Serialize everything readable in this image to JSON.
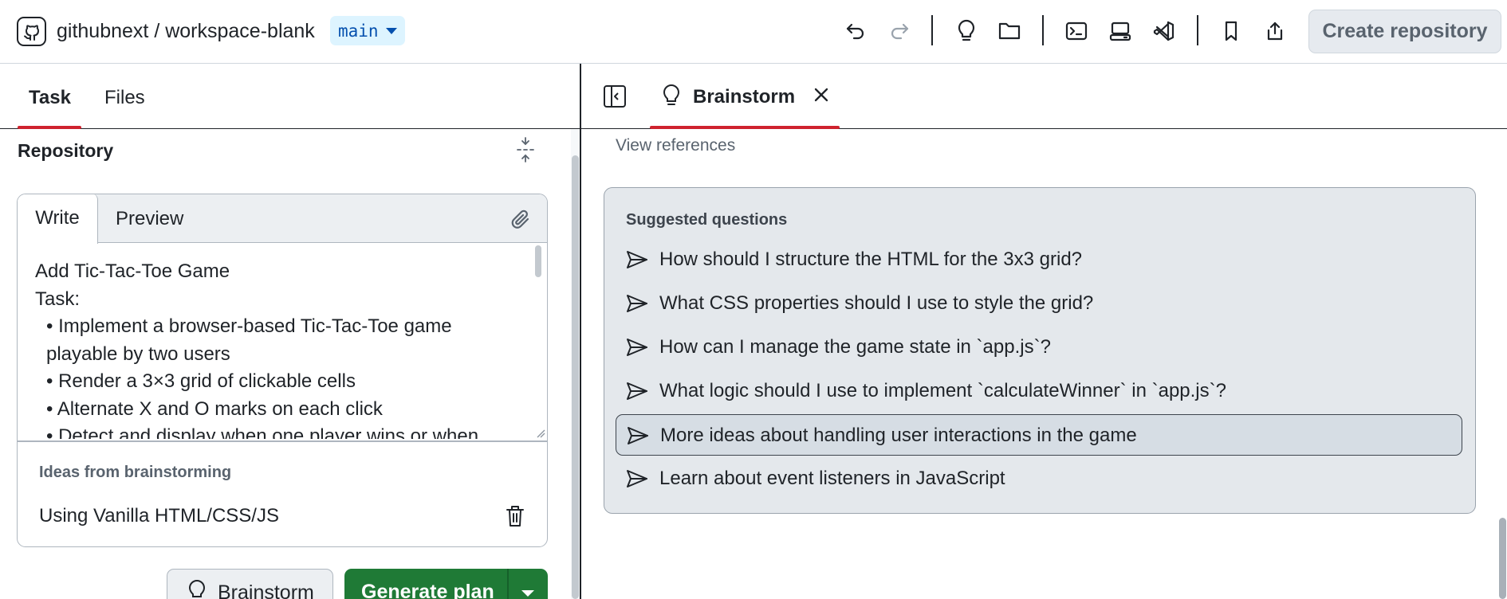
{
  "header": {
    "owner": "githubnext",
    "separator": " / ",
    "repo": "workspace-blank",
    "branch": "main",
    "create_label": "Create repository",
    "icons": [
      "undo-icon",
      "redo-icon",
      "lightbulb-icon",
      "folder-icon",
      "terminal-icon",
      "codespace-icon",
      "vscode-icon",
      "bookmark-icon",
      "share-icon"
    ]
  },
  "left": {
    "tabs": [
      {
        "label": "Task",
        "active": true
      },
      {
        "label": "Files",
        "active": false
      }
    ],
    "section_title": "Repository",
    "editor": {
      "tab_write": "Write",
      "tab_preview": "Preview",
      "lines": [
        "Add Tic-Tac-Toe Game",
        "Task:",
        "• Implement a browser-based Tic-Tac-Toe game playable by two users",
        "• Render a 3×3 grid of clickable cells",
        "• Alternate X and O marks on each click",
        "• Detect and display when one player wins or when"
      ]
    },
    "ideas": {
      "title": "Ideas from brainstorming",
      "items": [
        "Using Vanilla HTML/CSS/JS"
      ]
    },
    "brainstorm_label": "Brainstorm",
    "generate_label": "Generate plan"
  },
  "right": {
    "tab_label": "Brainstorm",
    "view_references": "View references",
    "suggested": {
      "title": "Suggested questions",
      "items": [
        "How should I structure the HTML for the 3x3 grid?",
        "What CSS properties should I use to style the grid?",
        "How can I manage the game state in `app.js`?",
        "What logic should I use to implement `calculateWinner` in `app.js`?",
        "More ideas about handling user interactions in the game",
        "Learn about event listeners in JavaScript"
      ]
    }
  },
  "colors": {
    "accent_red": "#cf222e",
    "primary_green": "#1f7a36",
    "branch_blue": "#0550ae",
    "branch_bg": "#ddf4ff"
  }
}
